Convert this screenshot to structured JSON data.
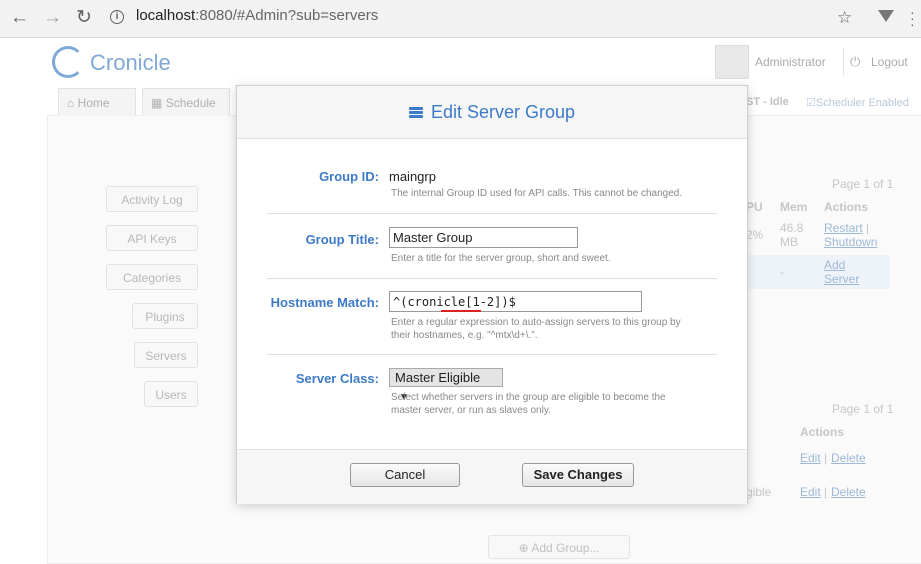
{
  "browser": {
    "url_host": "localhost",
    "url_rest": ":8080/#Admin?sub=servers"
  },
  "app": {
    "logo": "Cronicle",
    "user": "Administrator",
    "logout": "Logout",
    "tabs": {
      "home": "Home",
      "schedule": "Schedule"
    },
    "status_left": "ST - Idle",
    "status_right": "Scheduler Enabled",
    "sidebar": [
      "Activity Log",
      "API Keys",
      "Categories",
      "Plugins",
      "Servers",
      "Users"
    ],
    "page_label_1": "Page 1 of 1",
    "page_label_2": "Page 1 of 1",
    "headers": {
      "cpu": "PU",
      "mem": "Mem",
      "actions": "Actions",
      "actions2": "Actions"
    },
    "row1": {
      "cpu": "2%",
      "mem_val": "46.8",
      "mem_unit": "MB",
      "restart": "Restart",
      "shutdown": "Shutdown"
    },
    "row2": {
      "dash": "-",
      "add": "Add",
      "server": "Server"
    },
    "group_rows": [
      {
        "text": "",
        "edit": "Edit",
        "delete": "Delete"
      },
      {
        "text": "gible",
        "edit": "Edit",
        "delete": "Delete"
      }
    ],
    "add_group": "Add Group..."
  },
  "dialog": {
    "title": "Edit Server Group",
    "group_id": {
      "label": "Group ID:",
      "value": "maingrp",
      "caption": "The internal Group ID used for API calls. This cannot be changed."
    },
    "group_title": {
      "label": "Group Title:",
      "value": "Master Group",
      "caption": "Enter a title for the server group, short and sweet."
    },
    "hostname_match": {
      "label": "Hostname Match:",
      "value": "^(cronicle[1-2])$",
      "caption_line1": "Enter a regular expression to auto-assign servers to this group by",
      "caption_line2": "their hostnames, e.g. \"^mtx\\d+\\.\"."
    },
    "server_class": {
      "label": "Server Class:",
      "value": "Master Eligible",
      "caption_line1": "Select whether servers in the group are eligible to become the",
      "caption_line2": "master server, or run as slaves only."
    },
    "cancel": "Cancel",
    "save": "Save Changes"
  }
}
